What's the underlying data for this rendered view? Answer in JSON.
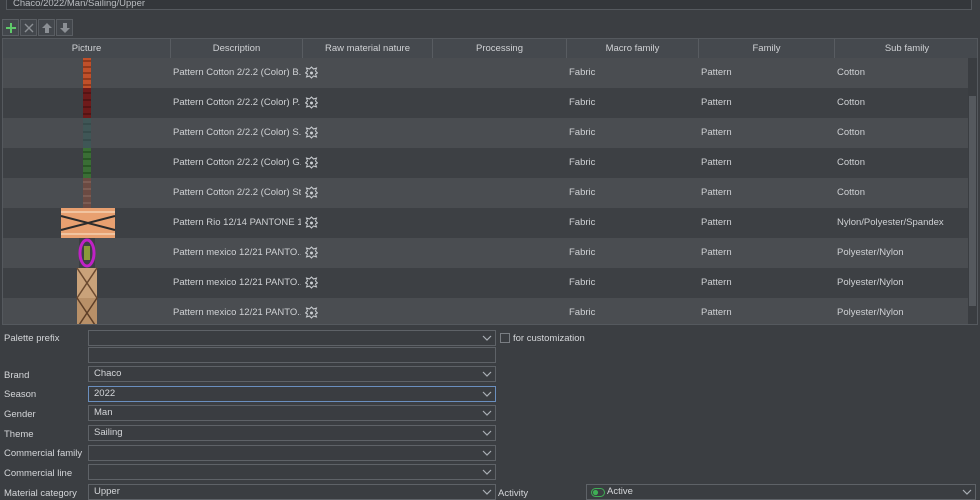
{
  "path": "Chaco/2022/Man/Sailing/Upper",
  "toolbar": {
    "add_icon": "plus-icon",
    "remove_icon": "x-icon",
    "up_icon": "arrow-up-icon",
    "down_icon": "arrow-down-icon"
  },
  "columns": [
    "Picture",
    "Description",
    "Raw material nature",
    "Processing",
    "Macro family",
    "Family",
    "Sub family"
  ],
  "rows": [
    {
      "description": "Pattern Cotton 2/2.2 (Color) B...",
      "macro": "Fabric",
      "family": "Pattern",
      "sub": "Cotton",
      "swatch": "orange-red"
    },
    {
      "description": "Pattern Cotton 2/2.2 (Color) P...",
      "macro": "Fabric",
      "family": "Pattern",
      "sub": "Cotton",
      "swatch": "dark-red"
    },
    {
      "description": "Pattern Cotton 2/2.2 (Color) S...",
      "macro": "Fabric",
      "family": "Pattern",
      "sub": "Cotton",
      "swatch": "slate"
    },
    {
      "description": "Pattern Cotton 2/2.2 (Color) G...",
      "macro": "Fabric",
      "family": "Pattern",
      "sub": "Cotton",
      "swatch": "green"
    },
    {
      "description": "Pattern Cotton 2/2.2 (Color) St...",
      "macro": "Fabric",
      "family": "Pattern",
      "sub": "Cotton",
      "swatch": "brown"
    },
    {
      "description": "Pattern Rio 12/14 PANTONE 1...",
      "macro": "Fabric",
      "family": "Pattern",
      "sub": "Nylon/Polyester/Spandex",
      "swatch": "rio"
    },
    {
      "description": "Pattern mexico 12/21 PANTO...",
      "macro": "Fabric",
      "family": "Pattern",
      "sub": "Polyester/Nylon",
      "swatch": "magenta"
    },
    {
      "description": "Pattern mexico 12/21 PANTO...",
      "macro": "Fabric",
      "family": "Pattern",
      "sub": "Polyester/Nylon",
      "swatch": "tan"
    },
    {
      "description": "Pattern mexico 12/21 PANTO...",
      "macro": "Fabric",
      "family": "Pattern",
      "sub": "Polyester/Nylon",
      "swatch": "tan2"
    }
  ],
  "form": {
    "palette_prefix_label": "Palette prefix",
    "palette_prefix_value": "",
    "for_customization_label": "for customization",
    "brand_label": "Brand",
    "brand_value": "Chaco",
    "season_label": "Season",
    "season_value": "2022",
    "gender_label": "Gender",
    "gender_value": "Man",
    "theme_label": "Theme",
    "theme_value": "Sailing",
    "commercial_family_label": "Commercial family",
    "commercial_family_value": "",
    "commercial_line_label": "Commercial line",
    "commercial_line_value": "",
    "material_category_label": "Material category",
    "material_category_value": "Upper",
    "activity_label": "Activity",
    "activity_value": "Active"
  },
  "colors": {
    "accent_focus": "#6a8fbf",
    "add_green": "#5fc96a",
    "toggle_green": "#3fae55"
  }
}
